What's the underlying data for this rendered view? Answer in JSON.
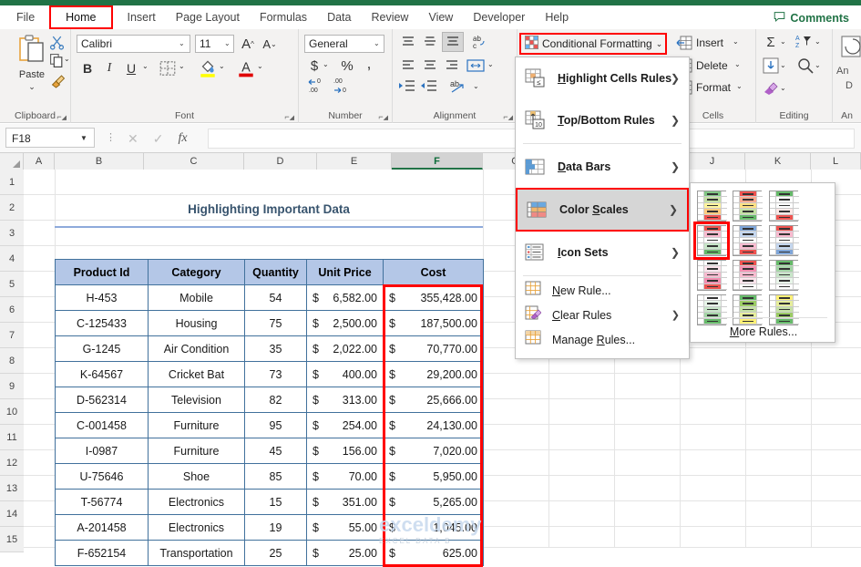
{
  "app": {
    "accent_green": "#217346",
    "red_highlight": "#ff0000"
  },
  "tabs": [
    {
      "label": "File",
      "active": false
    },
    {
      "label": "Home",
      "active": true
    },
    {
      "label": "Insert",
      "active": false
    },
    {
      "label": "Page Layout",
      "active": false
    },
    {
      "label": "Formulas",
      "active": false
    },
    {
      "label": "Data",
      "active": false
    },
    {
      "label": "Review",
      "active": false
    },
    {
      "label": "View",
      "active": false
    },
    {
      "label": "Developer",
      "active": false
    },
    {
      "label": "Help",
      "active": false
    }
  ],
  "comments_button": {
    "label": "Comments",
    "icon": "comment-icon"
  },
  "ribbon": {
    "groups": [
      {
        "name": "Clipboard",
        "label": "Clipboard"
      },
      {
        "name": "Font",
        "label": "Font"
      },
      {
        "name": "Number",
        "label": "Number"
      },
      {
        "name": "Alignment",
        "label": "Alignment"
      },
      {
        "name": "Styles",
        "label": ""
      },
      {
        "name": "Cells",
        "label": "Cells"
      },
      {
        "name": "Editing",
        "label": "Editing"
      },
      {
        "name": "Analysis",
        "label": "An"
      }
    ],
    "clipboard": {
      "paste_label": "Paste"
    },
    "font": {
      "font_name": "Calibri",
      "font_size": "11"
    },
    "number": {
      "format": "General"
    },
    "cells": {
      "insert": "Insert",
      "delete": "Delete",
      "format": "Format"
    },
    "analysis": {
      "line1": "An",
      "line2": "D"
    },
    "conditional_formatting": {
      "label": "Conditional Formatting"
    }
  },
  "formula_bar": {
    "name_box": "F18",
    "formula": "",
    "cancel_icon": "close-icon",
    "enter_icon": "check-icon",
    "function_icon": "fx-icon"
  },
  "grid": {
    "columns": [
      "A",
      "B",
      "C",
      "D",
      "E",
      "F",
      "G",
      "H",
      "I",
      "J",
      "K",
      "L"
    ],
    "selected_column": "F",
    "rows": [
      "1",
      "2",
      "3",
      "4",
      "5",
      "6",
      "7",
      "8",
      "9",
      "10",
      "11",
      "12",
      "13",
      "14",
      "15"
    ]
  },
  "sheet": {
    "title": "Highlighting Important Data",
    "headers": [
      "Product Id",
      "Category",
      "Quantity",
      "Unit Price",
      "Cost"
    ],
    "rows": [
      {
        "product_id": "H-453",
        "category": "Mobile",
        "quantity": "54",
        "unit_price": "6,582.00",
        "cost": "355,428.00"
      },
      {
        "product_id": "C-125433",
        "category": "Housing",
        "quantity": "75",
        "unit_price": "2,500.00",
        "cost": "187,500.00"
      },
      {
        "product_id": "G-1245",
        "category": "Air Condition",
        "quantity": "35",
        "unit_price": "2,022.00",
        "cost": "70,770.00"
      },
      {
        "product_id": "K-64567",
        "category": "Cricket Bat",
        "quantity": "73",
        "unit_price": "400.00",
        "cost": "29,200.00"
      },
      {
        "product_id": "D-562314",
        "category": "Television",
        "quantity": "82",
        "unit_price": "313.00",
        "cost": "25,666.00"
      },
      {
        "product_id": "C-001458",
        "category": "Furniture",
        "quantity": "95",
        "unit_price": "254.00",
        "cost": "24,130.00"
      },
      {
        "product_id": "I-0987",
        "category": "Furniture",
        "quantity": "45",
        "unit_price": "156.00",
        "cost": "7,020.00"
      },
      {
        "product_id": "U-75646",
        "category": "Shoe",
        "quantity": "85",
        "unit_price": "70.00",
        "cost": "5,950.00"
      },
      {
        "product_id": "T-56774",
        "category": "Electronics",
        "quantity": "15",
        "unit_price": "351.00",
        "cost": "5,265.00"
      },
      {
        "product_id": "A-201458",
        "category": "Electronics",
        "quantity": "19",
        "unit_price": "55.00",
        "cost": "1,045.00"
      },
      {
        "product_id": "F-652154",
        "category": "Transportation",
        "quantity": "25",
        "unit_price": "25.00",
        "cost": "625.00"
      }
    ],
    "currency_symbol": "$",
    "header_fill": "#b4c7e7",
    "border_color": "#41719c",
    "title_color": "#38546e"
  },
  "watermark": {
    "text": "exceldemy",
    "subtext": "EXCEL  DATA  B"
  },
  "cf_menu": {
    "items": [
      {
        "label": "Highlight Cells Rules",
        "icon": "highlight-cells-icon",
        "has_submenu": true,
        "selected": false
      },
      {
        "label": "Top/Bottom Rules",
        "icon": "top-bottom-icon",
        "has_submenu": true,
        "selected": false
      },
      {
        "label": "Data Bars",
        "icon": "data-bars-icon",
        "has_submenu": true,
        "selected": false
      },
      {
        "label": "Color Scales",
        "icon": "color-scales-icon",
        "has_submenu": true,
        "selected": true
      },
      {
        "label": "Icon Sets",
        "icon": "icon-sets-icon",
        "has_submenu": true,
        "selected": false
      },
      {
        "label": "New Rule...",
        "icon": "new-rule-icon",
        "has_submenu": false,
        "selected": false
      },
      {
        "label": "Clear Rules",
        "icon": "clear-rules-icon",
        "has_submenu": true,
        "selected": false
      },
      {
        "label": "Manage Rules...",
        "icon": "manage-rules-icon",
        "has_submenu": false,
        "selected": false
      }
    ]
  },
  "color_scales_submenu": {
    "more_rules_label": "More Rules...",
    "thumbnails": [
      {
        "id": "gyr-green-top",
        "colors": [
          "#81c784",
          "#c5e1a5",
          "#fff59d",
          "#ffcc80",
          "#ef5350"
        ],
        "selected": false
      },
      {
        "id": "ryg-red-top",
        "colors": [
          "#ef5350",
          "#ffab91",
          "#ffe082",
          "#c5e1a5",
          "#66bb6a"
        ],
        "selected": false
      },
      {
        "id": "grw-green-white-red",
        "colors": [
          "#66bb6a",
          "#ffffff",
          "#ffffff",
          "#fbe9e7",
          "#ef5350"
        ],
        "selected": false
      },
      {
        "id": "rwg-red-white-green",
        "colors": [
          "#ef5350",
          "#f8bbd0",
          "#ffffff",
          "#c8e6c9",
          "#66bb6a"
        ],
        "selected": true
      },
      {
        "id": "bwr-blue-white-red",
        "colors": [
          "#7fa6d9",
          "#c5d7ef",
          "#ffffff",
          "#f8bbd0",
          "#ef5350"
        ],
        "selected": false
      },
      {
        "id": "rwb-red-white-blue",
        "colors": [
          "#ef5350",
          "#f8bbd0",
          "#ffffff",
          "#c5d7ef",
          "#7fa6d9"
        ],
        "selected": false
      },
      {
        "id": "wr-white-red",
        "colors": [
          "#ffffff",
          "#fce4ec",
          "#f8bbd0",
          "#f48fb1",
          "#ef5350"
        ],
        "selected": false
      },
      {
        "id": "rw-red-white",
        "colors": [
          "#ef5350",
          "#f48fb1",
          "#f8bbd0",
          "#fce4ec",
          "#ffffff"
        ],
        "selected": false
      },
      {
        "id": "gw-green-white",
        "colors": [
          "#66bb6a",
          "#a5d6a7",
          "#c8e6c9",
          "#e8f5e9",
          "#ffffff"
        ],
        "selected": false
      },
      {
        "id": "wg-white-green",
        "colors": [
          "#ffffff",
          "#e8f5e9",
          "#c8e6c9",
          "#a5d6a7",
          "#66bb6a"
        ],
        "selected": false
      },
      {
        "id": "gy-green-yellow",
        "colors": [
          "#66bb6a",
          "#9ccc65",
          "#c5e1a5",
          "#e6ee9c",
          "#fff176"
        ],
        "selected": false
      },
      {
        "id": "yg-yellow-green",
        "colors": [
          "#fff176",
          "#e6ee9c",
          "#c5e1a5",
          "#9ccc65",
          "#66bb6a"
        ],
        "selected": false
      }
    ]
  }
}
